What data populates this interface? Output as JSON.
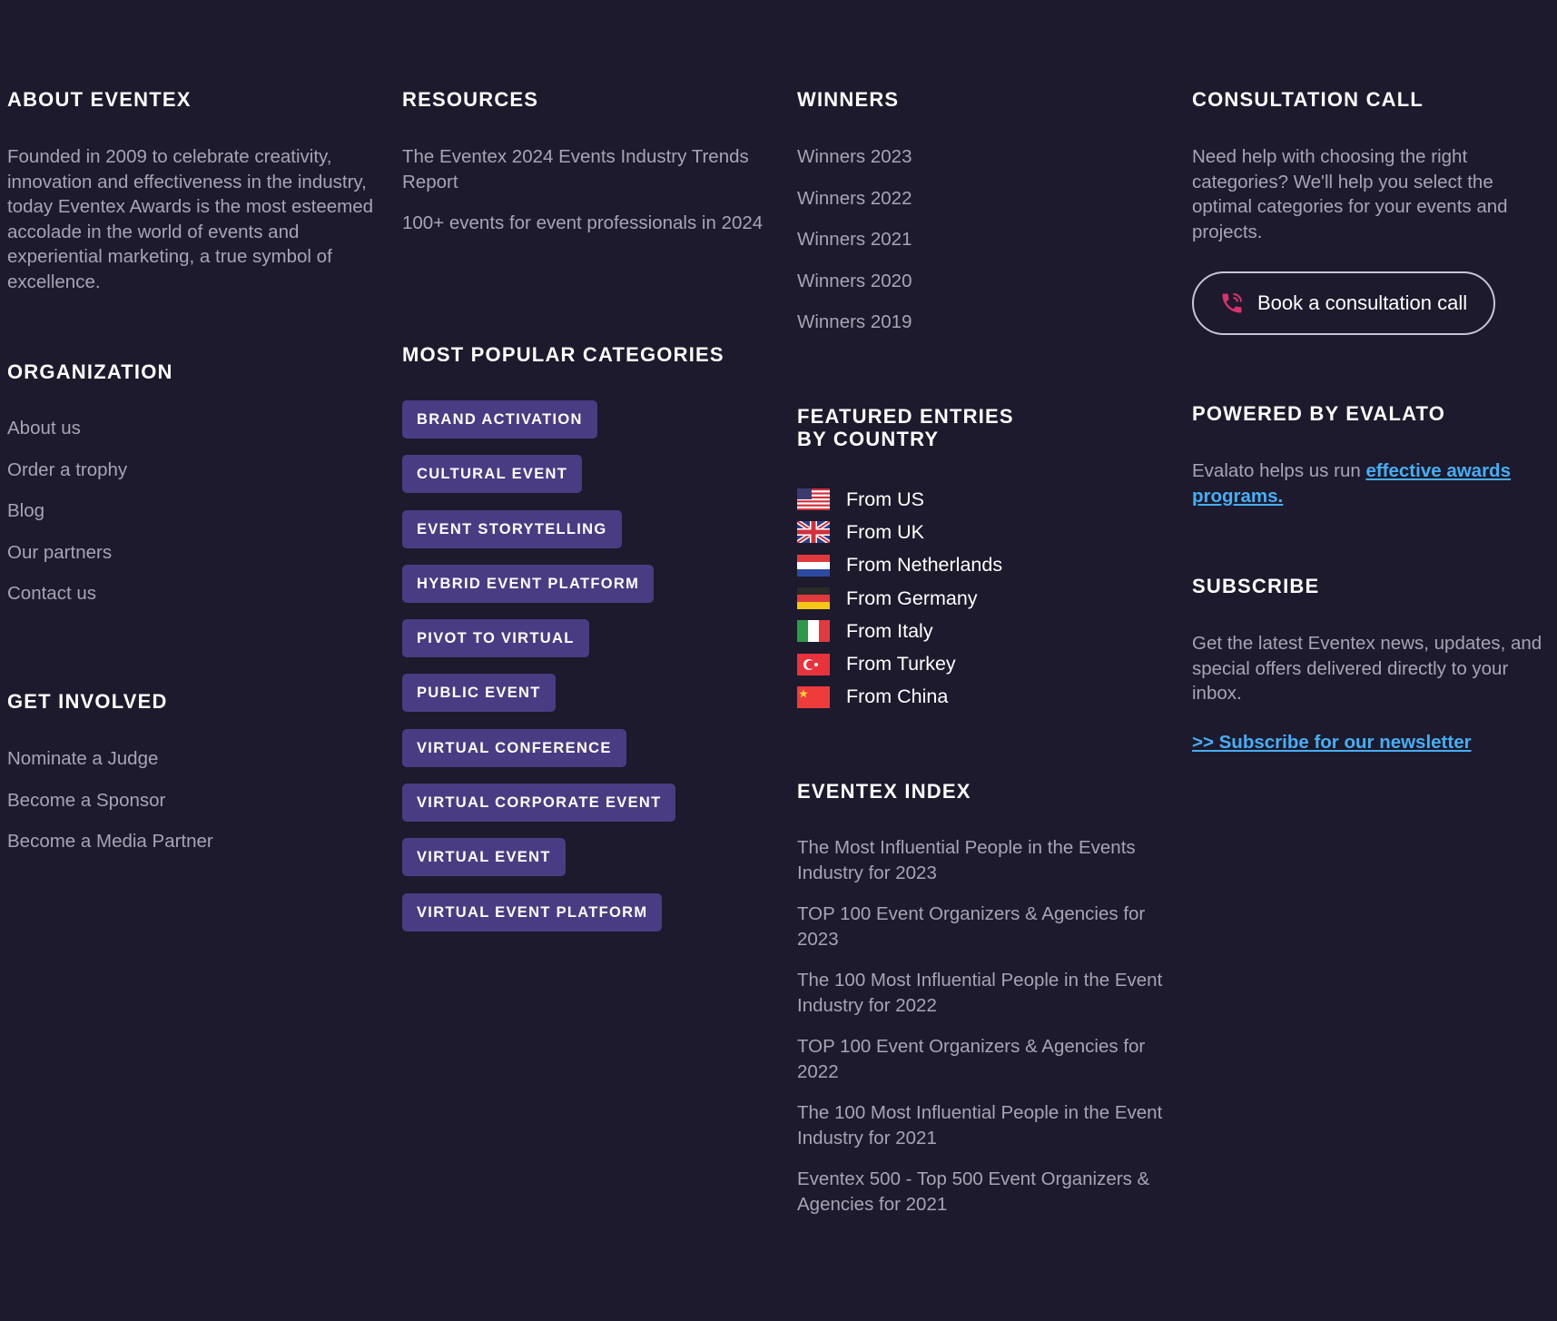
{
  "about": {
    "title": "ABOUT EVENTEX",
    "text": "Founded in 2009 to celebrate creativity, innovation and effectiveness in the industry, today Eventex Awards is the most esteemed accolade in the world of events and experiential marketing, a true symbol of excellence."
  },
  "organization": {
    "title": "ORGANIZATION",
    "items": [
      "About us",
      "Order a trophy",
      "Blog",
      "Our partners",
      "Contact us"
    ]
  },
  "get_involved": {
    "title": "GET INVOLVED",
    "items": [
      "Nominate a Judge",
      "Become a Sponsor",
      "Become a Media Partner"
    ]
  },
  "resources": {
    "title": "RESOURCES",
    "items": [
      "The Eventex 2024 Events Industry Trends Report",
      "100+ events for event professionals in 2024"
    ]
  },
  "categories": {
    "title": "MOST POPULAR CATEGORIES",
    "items": [
      "BRAND ACTIVATION",
      "CULTURAL EVENT",
      "EVENT STORYTELLING",
      "HYBRID EVENT PLATFORM",
      "PIVOT TO VIRTUAL",
      "PUBLIC EVENT",
      "VIRTUAL CONFERENCE",
      "VIRTUAL CORPORATE EVENT",
      "VIRTUAL EVENT",
      "VIRTUAL EVENT PLATFORM"
    ]
  },
  "winners": {
    "title": "WINNERS",
    "items": [
      "Winners 2023",
      "Winners 2022",
      "Winners 2021",
      "Winners 2020",
      "Winners 2019"
    ]
  },
  "featured": {
    "title_line1": "FEATURED ENTRIES",
    "title_line2": "BY COUNTRY",
    "items": [
      {
        "label": "From US",
        "flag": "us-flag-icon"
      },
      {
        "label": "From UK",
        "flag": "uk-flag-icon"
      },
      {
        "label": "From Netherlands",
        "flag": "netherlands-flag-icon"
      },
      {
        "label": "From Germany",
        "flag": "germany-flag-icon"
      },
      {
        "label": "From Italy",
        "flag": "italy-flag-icon"
      },
      {
        "label": "From Turkey",
        "flag": "turkey-flag-icon"
      },
      {
        "label": "From China",
        "flag": "china-flag-icon"
      }
    ]
  },
  "index": {
    "title": "EVENTEX INDEX",
    "items": [
      "The Most Influential People in the Events Industry for 2023",
      "TOP 100 Event Organizers & Agencies for 2023",
      "The 100 Most Influential People in the Event Industry for 2022",
      "TOP 100 Event Organizers & Agencies for 2022",
      "The 100 Most Influential People in the Event Industry for 2021",
      "Eventex 500 - Top 500 Event Organizers & Agencies for 2021"
    ]
  },
  "consultation": {
    "title": "CONSULTATION CALL",
    "text": "Need help with choosing the right categories? We'll help you select the optimal categories for your events and projects.",
    "button_label": "Book a consultation call",
    "button_icon": "phone-icon"
  },
  "powered": {
    "title": "POWERED BY EVALATO",
    "text": "Evalato helps us run ",
    "link": "effective awards programs."
  },
  "subscribe": {
    "title": "SUBSCRIBE",
    "text": "Get the latest Eventex news, updates, and special offers delivered directly to your inbox.",
    "link": ">> Subscribe for our newsletter"
  },
  "colors": {
    "background": "#1c1a2c",
    "heading": "#ffffff",
    "body_text": "#a7a4b3",
    "tag_background": "#4a3c82",
    "link": "#47aef5",
    "phone_icon": "#d9336b"
  }
}
